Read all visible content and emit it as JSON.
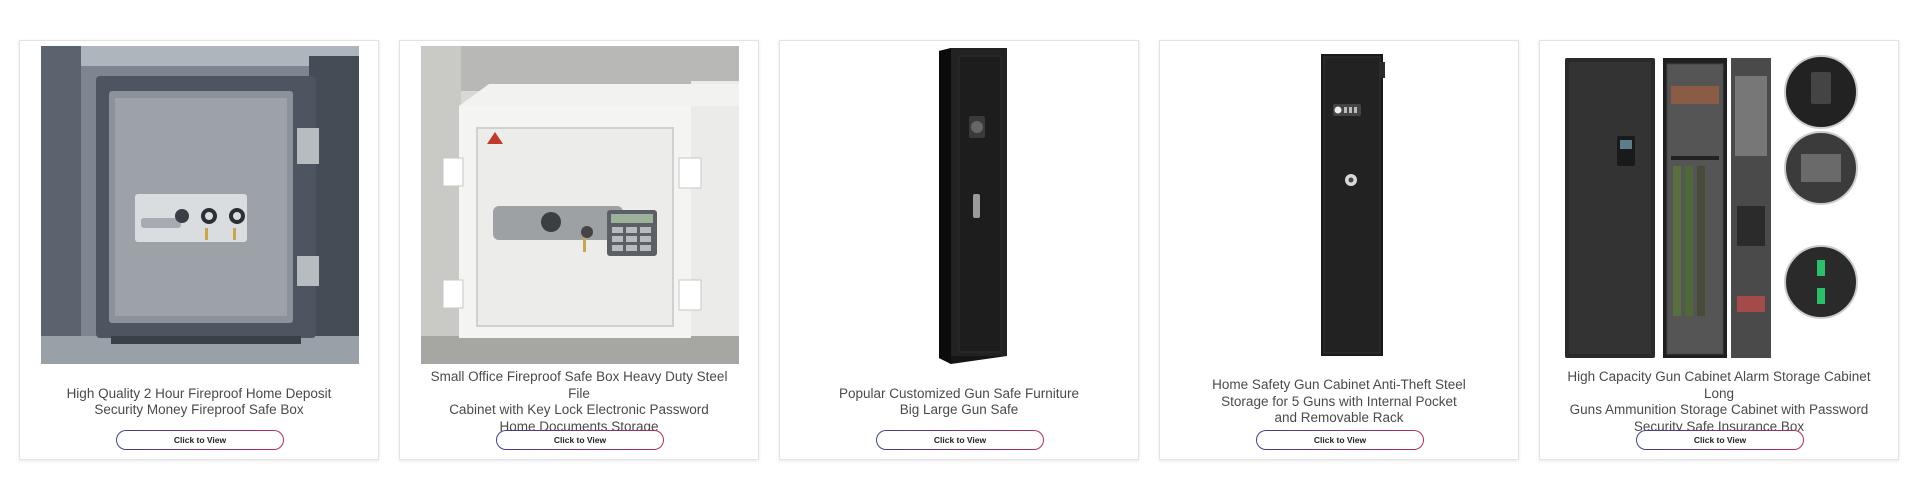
{
  "products": [
    {
      "title_lines": [
        "High Quality 2 Hour Fireproof Home Deposit",
        "Security Money Fireproof Safe Box"
      ],
      "button_label": "Click to View"
    },
    {
      "title_lines": [
        "Small Office Fireproof Safe Box Heavy Duty Steel File",
        "Cabinet with Key Lock Electronic Password",
        "Home Documents Storage"
      ],
      "button_label": "Click to View"
    },
    {
      "title_lines": [
        "Popular Customized Gun Safe Furniture",
        "Big Large Gun Safe"
      ],
      "button_label": "Click to View"
    },
    {
      "title_lines": [
        "Home Safety Gun Cabinet Anti-Theft Steel",
        "Storage for 5 Guns with Internal Pocket",
        "and Removable Rack"
      ],
      "button_label": "Click to View"
    },
    {
      "title_lines": [
        "High Capacity Gun Cabinet Alarm Storage Cabinet Long",
        "Guns Ammunition Storage Cabinet with Password",
        "Security Safe Insurance Box"
      ],
      "button_label": "Click to View"
    }
  ],
  "colors": {
    "button_gradient_start": "#3b3f8f",
    "button_gradient_end": "#b32b5d",
    "title_text": "#4a4a4a",
    "card_border": "#e3e3e3"
  }
}
